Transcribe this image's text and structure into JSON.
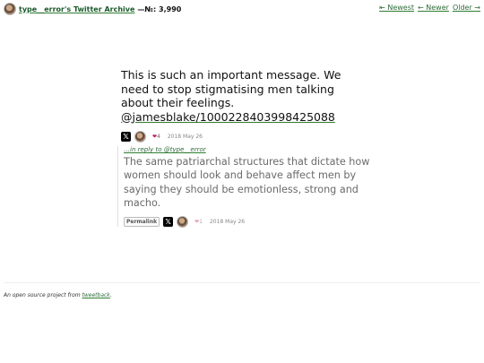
{
  "header": {
    "title": "type__error's Twitter Archive",
    "count": "—№: 3,990",
    "nav": {
      "newest": "⇤ Newest",
      "newer": "← Newer",
      "older": "Older →"
    }
  },
  "tweet": {
    "text": "This is such an important message. We need to stop stigmatising men talking about their feelings. ",
    "link": "@jamesblake/1000228403998425088",
    "likes": "4",
    "date": "2018 May 26",
    "icons": {
      "platform": "x-logo-icon",
      "like": "heart-icon"
    }
  },
  "reply": {
    "in_reply_to": "…in reply to @type__error",
    "text": "The same patriarchal structures that dictate how women should look and behave affect men by saying they should be emotionless, strong and macho.",
    "permalink": "Permalink",
    "likes": "1",
    "date": "2018 May 26"
  },
  "footer": {
    "prefix": "An open source project from ",
    "link": "tweetback",
    "suffix": "."
  },
  "colors": {
    "link": "#2e6b3a",
    "heart": "#c2185b",
    "reply_text": "#6a6a6a"
  }
}
